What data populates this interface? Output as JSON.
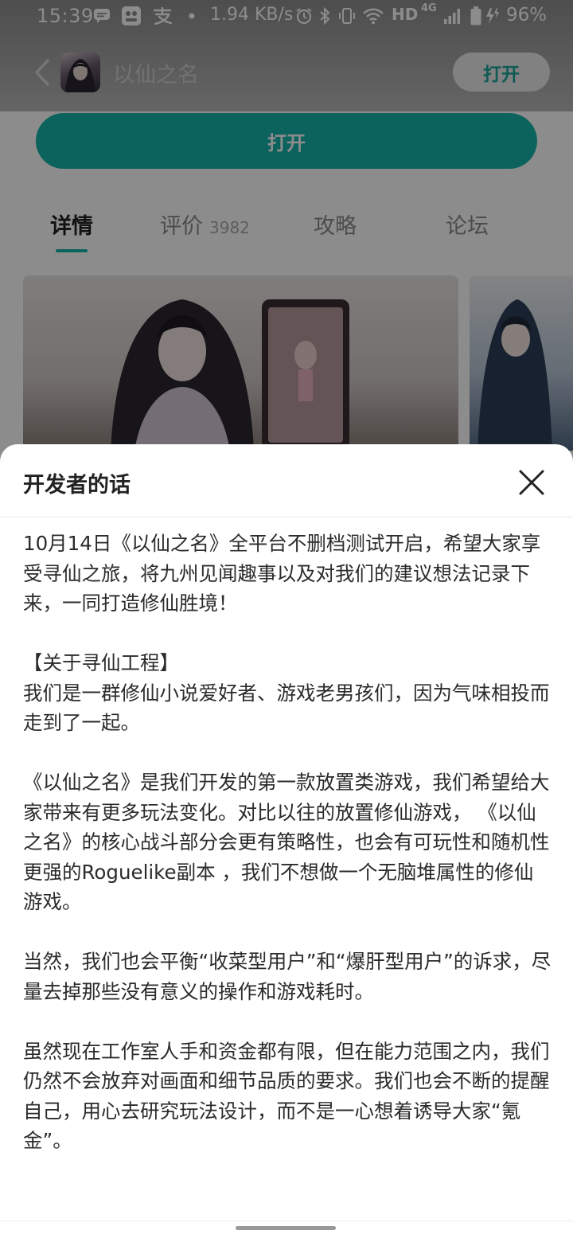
{
  "status_bar": {
    "time": "15:39",
    "network_speed": "1.94 KB/s",
    "hd_label": "HD",
    "net_type": "4G",
    "battery_percent": "96%"
  },
  "app_header": {
    "title": "以仙之名",
    "open_button": "打开"
  },
  "main_open_button": "打开",
  "tabs": [
    {
      "label": "详情",
      "active": true
    },
    {
      "label": "评价",
      "count": "3982"
    },
    {
      "label": "攻略"
    },
    {
      "label": "论坛"
    }
  ],
  "sheet": {
    "title": "开发者的话",
    "paragraphs": [
      "10月14日《以仙之名》全平台不删档测试开启，希望大家享受寻仙之旅，将九州见闻趣事以及对我们的建议想法记录下来，一同打造修仙胜境！",
      "【关于寻仙工程】\n我们是一群修仙小说爱好者、游戏老男孩们，因为气味相投而走到了一起。",
      "《以仙之名》是我们开发的第一款放置类游戏，我们希望给大家带来有更多玩法变化。对比以往的放置修仙游戏， 《以仙之名》的核心战斗部分会更有策略性，也会有可玩性和随机性更强的Roguelike副本 ，我们不想做一个无脑堆属性的修仙游戏。",
      "当然，我们也会平衡“收菜型用户”和“爆肝型用户”的诉求，尽量去掉那些没有意义的操作和游戏耗时。",
      "虽然现在工作室人手和资金都有限，但在能力范围之内，我们仍然不会放弃对画面和细节品质的要求。我们也会不断的提醒自己，用心去研究玩法设计，而不是一心想着诱导大家“氪金”。"
    ]
  },
  "colors": {
    "accent": "#17b4ac",
    "overlay": "rgba(0,0,0,0.45)",
    "text": "#2b2b2b"
  }
}
